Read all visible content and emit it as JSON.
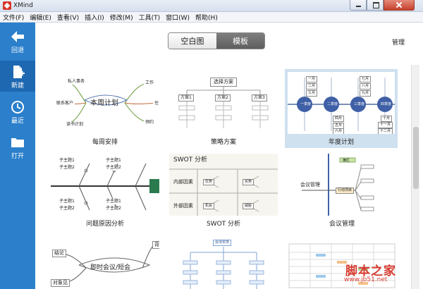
{
  "window": {
    "title": "XMind"
  },
  "menu": [
    "文件(F)",
    "编辑(E)",
    "查看(V)",
    "插入(I)",
    "修改(M)",
    "工具(T)",
    "窗口(W)",
    "帮助(H)"
  ],
  "sidebar": {
    "items": [
      {
        "label": "回退",
        "icon": "arrow-left-icon"
      },
      {
        "label": "新建",
        "icon": "new-document-icon"
      },
      {
        "label": "最近",
        "icon": "clock-icon"
      },
      {
        "label": "打开",
        "icon": "folder-icon"
      }
    ],
    "active": "新建"
  },
  "segmented": {
    "blank": "空白图",
    "templates": "模板",
    "selected": "模板"
  },
  "manage_label": "管理",
  "templates": [
    {
      "name": "每周安排",
      "preview": {
        "center": "本周计划",
        "branches": [
          "私人事务",
          "联系客户",
          "读书计划",
          "工作",
          "住",
          "预约"
        ]
      }
    },
    {
      "name": "策略方案",
      "preview": {
        "root": "选择方案",
        "options": [
          "方案1",
          "方案2",
          "方案3"
        ]
      }
    },
    {
      "name": "年度计划",
      "selected": true,
      "preview": {
        "quarters": [
          "一季度",
          "二季度",
          "三季度",
          "四季度"
        ],
        "months": [
          "一月",
          "二月",
          "三月",
          "四月",
          "五月",
          "六月",
          "七月",
          "八月",
          "九月",
          "十月",
          "十一月",
          "十二月"
        ]
      }
    },
    {
      "name": "问题原因分析",
      "preview": {
        "items": [
          "子主题1",
          "子主题2",
          "子主题1",
          "子主题2",
          "子主题1",
          "子主题2",
          "子主题1",
          "子主题2"
        ]
      }
    },
    {
      "name": "SWOT 分析",
      "preview": {
        "title": "SWOT 分析",
        "row1": "内部因素",
        "row2": "外部因素",
        "cells": [
          "优势",
          "劣势",
          "机会",
          "威胁"
        ]
      }
    },
    {
      "name": "会议管理",
      "preview": {
        "center": "会议管理",
        "topic": "行动项目",
        "other": "横栏"
      }
    },
    {
      "name": "",
      "preview": {
        "center": "即时会议/短会",
        "branches": [
          "结论",
          "对象见",
          "背"
        ]
      }
    },
    {
      "name": "",
      "preview": {
        "root": "会场安排"
      }
    },
    {
      "name": "",
      "preview": {}
    }
  ],
  "watermark": {
    "text": "脚本之家",
    "url": "www.jb51.net"
  }
}
